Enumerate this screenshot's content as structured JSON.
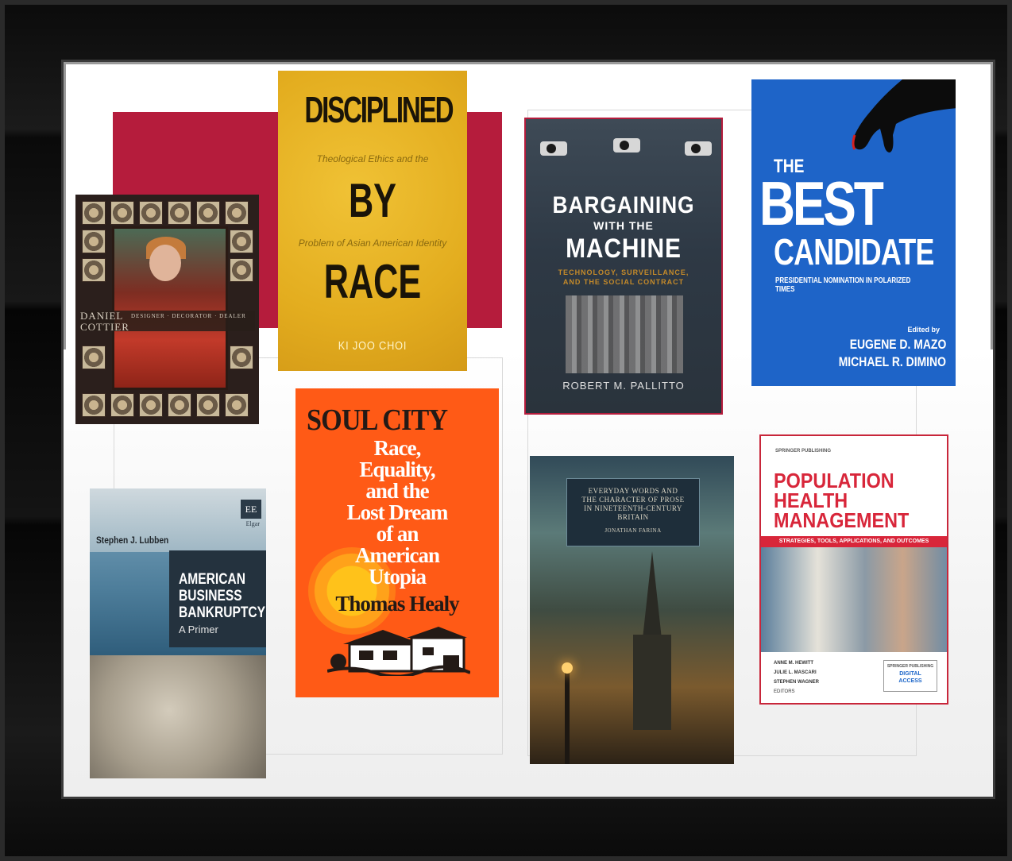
{
  "books": {
    "cotter": {
      "name_line1": "DANIEL",
      "name_line2": "COTTIER",
      "roles": "DESIGNER · DECORATOR · DEALER"
    },
    "disciplined": {
      "title_line1": "DISCIPLINED",
      "subtitle_line1": "Theological Ethics and the",
      "title_line2": "BY",
      "subtitle_line2": "Problem of Asian American Identity",
      "title_line3": "RACE",
      "author": "KI JOO CHOI"
    },
    "bargaining": {
      "title_line1": "BARGAINING",
      "title_line2": "WITH THE",
      "title_line3": "MACHINE",
      "subtitle_line1": "TECHNOLOGY, SURVEILLANCE,",
      "subtitle_line2": "AND THE SOCIAL CONTRACT",
      "author": "ROBERT M. PALLITTO"
    },
    "best_candidate": {
      "the": "THE",
      "best": "BEST",
      "candidate": "CANDIDATE",
      "subtitle": "PRESIDENTIAL NOMINATION IN POLARIZED TIMES",
      "edited_by": "Edited by",
      "editor1": "EUGENE D. MAZO",
      "editor2": "MICHAEL R. DIMINO"
    },
    "soul_city": {
      "title": "SOUL CITY",
      "line1": "Race,",
      "line2": "Equality,",
      "line3": "and the",
      "line4": "Lost Dream",
      "line5": "of an",
      "line6": "American",
      "line7": "Utopia",
      "author": "Thomas Healy"
    },
    "bankruptcy": {
      "author": "Stephen J. Lubben",
      "publisher_mark": "EE",
      "publisher_name": "Elgar",
      "title_line1": "AMERICAN",
      "title_line2": "BUSINESS",
      "title_line3": "BANKRUPTCY",
      "subtitle": "A Primer"
    },
    "everyday": {
      "title_line1": "EVERYDAY WORDS AND",
      "title_line2": "THE CHARACTER OF PROSE",
      "title_line3": "IN NINETEENTH-CENTURY",
      "title_line4": "BRITAIN",
      "author": "JONATHAN FARINA"
    },
    "population": {
      "publisher": "SPRINGER PUBLISHING",
      "title_line1": "POPULATION",
      "title_line2": "HEALTH",
      "title_line3": "MANAGEMENT",
      "subtitle": "STRATEGIES, TOOLS, APPLICATIONS, AND OUTCOMES",
      "editor1": "ANNE M. HEWITT",
      "editor2": "JULIE L. MASCARI",
      "editor3": "STEPHEN WAGNER",
      "editors_label": "EDITORS",
      "badge_line1": "SPRINGER PUBLISHING",
      "badge_line2": "DIGITAL",
      "badge_line3": "ACCESS"
    }
  },
  "colors": {
    "accent_red": "#b51c3c",
    "frame": "#0b0b0b",
    "mat": "#ffffff"
  }
}
